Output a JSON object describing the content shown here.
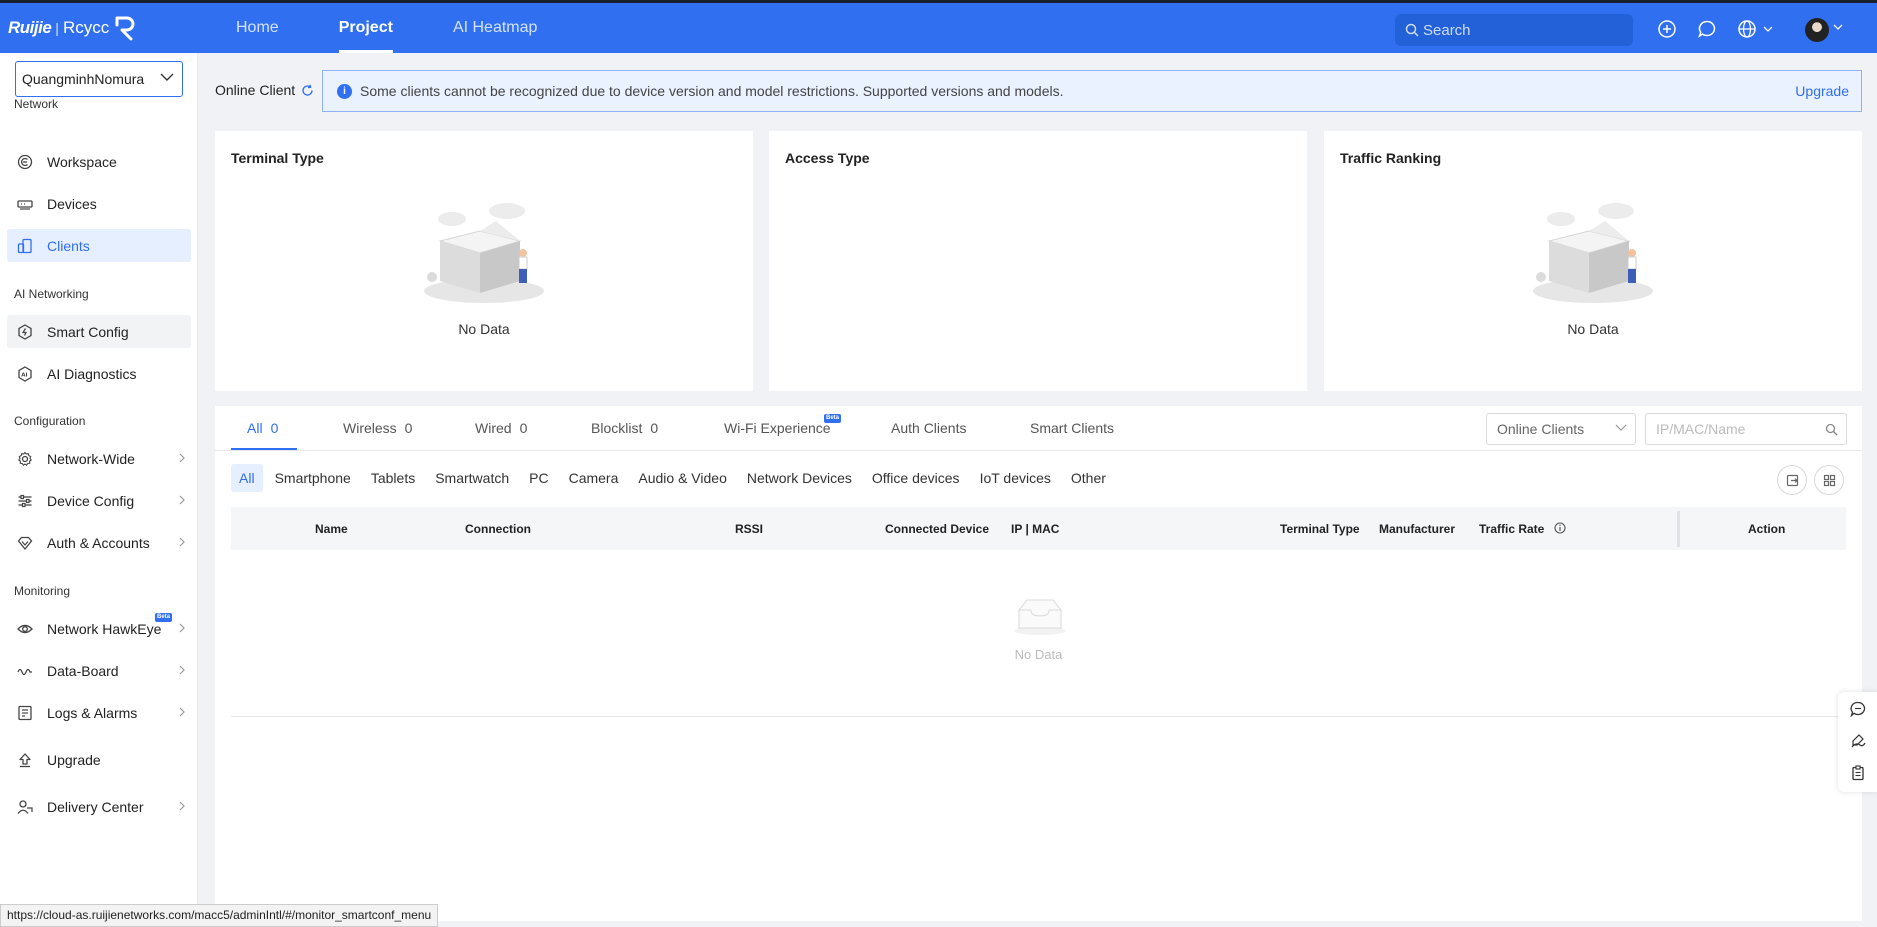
{
  "header": {
    "logo_brand": "Ruijie",
    "logo_sep": "|",
    "logo_sub": "Rcycc",
    "nav": [
      "Home",
      "Project",
      "AI Heatmap"
    ],
    "active_nav": "Project",
    "search_placeholder": "Search",
    "icons": [
      "plus-circle-icon",
      "chat-icon",
      "globe-icon",
      "chevron-down-icon"
    ]
  },
  "sidebar": {
    "org_name": "QuangminhNomura",
    "sections": {
      "network": "Network",
      "ai_networking": "AI Networking",
      "configuration": "Configuration",
      "monitoring": "Monitoring"
    },
    "items": {
      "workspace": "Workspace",
      "devices": "Devices",
      "clients": "Clients",
      "smart_config": "Smart Config",
      "ai_diagnostics": "AI Diagnostics",
      "network_wide": "Network-Wide",
      "device_config": "Device Config",
      "auth_accounts": "Auth & Accounts",
      "network_hawkeye": "Network HawkEye",
      "data_board": "Data-Board",
      "logs_alarms": "Logs & Alarms",
      "upgrade": "Upgrade",
      "delivery_center": "Delivery Center"
    },
    "beta_label": "Beta"
  },
  "main": {
    "online_client_label": "Online Client",
    "notice_text": "Some clients cannot be recognized due to device version and model restrictions. Supported versions and models.",
    "notice_link": "Upgrade",
    "cards": {
      "terminal_type": "Terminal Type",
      "access_type": "Access Type",
      "traffic_ranking": "Traffic Ranking",
      "no_data": "No Data"
    },
    "tabs": {
      "all": "All",
      "all_count": "0",
      "wireless": "Wireless",
      "wireless_count": "0",
      "wired": "Wired",
      "wired_count": "0",
      "blocklist": "Blocklist",
      "blocklist_count": "0",
      "wifi_experience": "Wi-Fi Experience",
      "auth_clients": "Auth Clients",
      "smart_clients": "Smart Clients"
    },
    "filter_select": "Online Clients",
    "search_placeholder": "IP/MAC/Name",
    "subtabs": [
      "All",
      "Smartphone",
      "Tablets",
      "Smartwatch",
      "PC",
      "Camera",
      "Audio & Video",
      "Network Devices",
      "Office devices",
      "IoT devices",
      "Other"
    ],
    "columns": {
      "name": "Name",
      "connection": "Connection",
      "rssi": "RSSI",
      "connected_device": "Connected Device",
      "ip_mac": "IP | MAC",
      "terminal_type": "Terminal Type",
      "manufacturer": "Manufacturer",
      "traffic_rate": "Traffic Rate",
      "action": "Action"
    },
    "table_empty": "No Data"
  },
  "status_bar_url": "https://cloud-as.ruijienetworks.com/macc5/adminIntl/#/monitor_smartconf_menu",
  "colors": {
    "primary": "#2f6ff0",
    "topbar": "#2f6ff0",
    "active_bg": "#e6efff"
  }
}
